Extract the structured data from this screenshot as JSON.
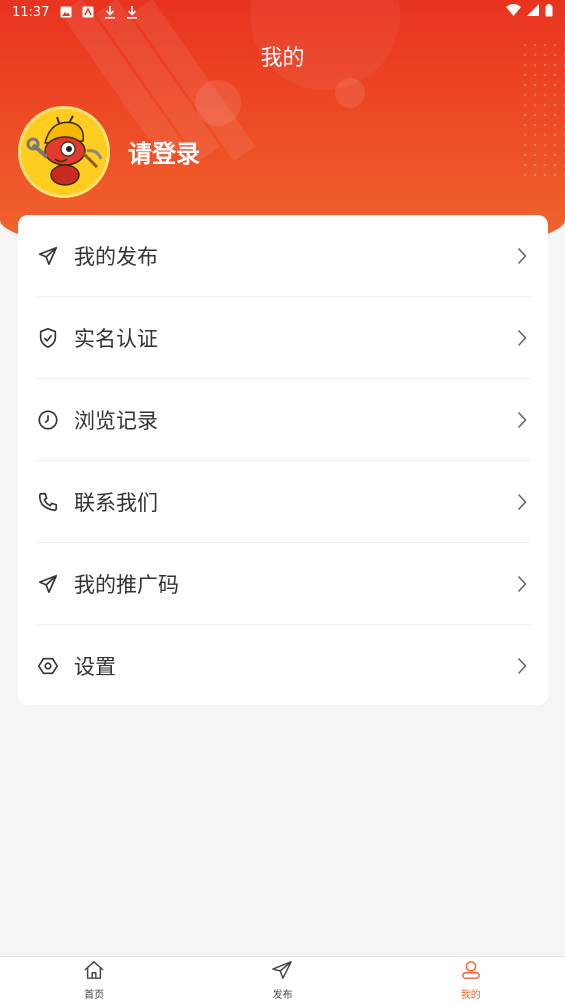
{
  "status_bar": {
    "time": "11:37"
  },
  "header": {
    "title": "我的"
  },
  "profile": {
    "login_text": "请登录"
  },
  "menu": [
    {
      "label": "我的发布",
      "icon": "send-icon"
    },
    {
      "label": "实名认证",
      "icon": "shield-check-icon"
    },
    {
      "label": "浏览记录",
      "icon": "clock-icon"
    },
    {
      "label": "联系我们",
      "icon": "phone-icon"
    },
    {
      "label": "我的推广码",
      "icon": "send-icon"
    },
    {
      "label": "设置",
      "icon": "settings-hexagon-icon"
    }
  ],
  "tabbar": [
    {
      "label": "首页",
      "icon": "home-icon",
      "active": false
    },
    {
      "label": "发布",
      "icon": "send-icon",
      "active": false
    },
    {
      "label": "我的",
      "icon": "user-icon",
      "active": true
    }
  ],
  "colors": {
    "accent": "#f0642d",
    "header_red": "#e8331f",
    "avatar_yellow": "#ffcd1f"
  }
}
